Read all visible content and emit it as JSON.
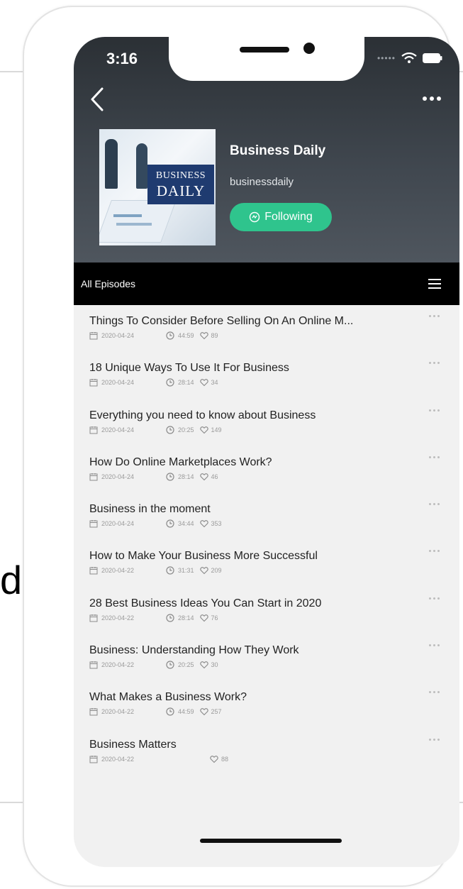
{
  "background_text": "d",
  "status": {
    "time": "3:16"
  },
  "podcast": {
    "cover_line1": "BUSINESS",
    "cover_line2": "DAILY",
    "title": "Business Daily",
    "handle": "businessdaily",
    "follow_label": "Following"
  },
  "tab": {
    "label": "All Episodes"
  },
  "episodes": [
    {
      "title": "Things To Consider Before Selling On An Online M...",
      "date": "2020-04-24",
      "duration": "44:59",
      "likes": "89"
    },
    {
      "title": "18 Unique Ways To Use It For Business",
      "date": "2020-04-24",
      "duration": "28:14",
      "likes": "34"
    },
    {
      "title": "Everything you need to know about Business",
      "date": "2020-04-24",
      "duration": "20:25",
      "likes": "149"
    },
    {
      "title": "How Do Online Marketplaces Work?",
      "date": "2020-04-24",
      "duration": "28:14",
      "likes": "46"
    },
    {
      "title": "Business in the moment",
      "date": "2020-04-24",
      "duration": "34:44",
      "likes": "353"
    },
    {
      "title": "How to Make Your Business More Successful",
      "date": "2020-04-22",
      "duration": "31:31",
      "likes": "209"
    },
    {
      "title": "28 Best Business Ideas You Can Start in 2020",
      "date": "2020-04-22",
      "duration": "28:14",
      "likes": "76"
    },
    {
      "title": "Business: Understanding How They Work",
      "date": "2020-04-22",
      "duration": "20:25",
      "likes": "30"
    },
    {
      "title": "What Makes a Business Work?",
      "date": "2020-04-22",
      "duration": "44:59",
      "likes": "257"
    },
    {
      "title": "Business Matters",
      "date": "2020-04-22",
      "duration": "",
      "likes": "88"
    }
  ],
  "colors": {
    "accent": "#2fc48d",
    "header_dark": "#2b3035",
    "tabbar": "#000000"
  }
}
